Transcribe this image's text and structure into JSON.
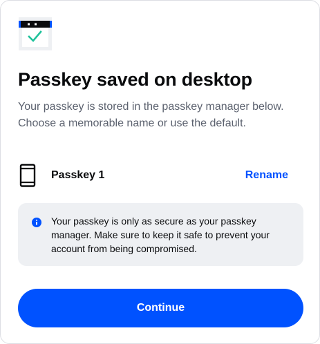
{
  "header": {
    "icon": "calendar-check-icon",
    "title": "Passkey saved on desktop",
    "subtitle": "Your passkey is stored in the passkey manager below. Choose a memorable name or use the default."
  },
  "passkey": {
    "icon": "phone-icon",
    "name": "Passkey 1",
    "rename_label": "Rename"
  },
  "info": {
    "icon": "info-icon",
    "text": "Your passkey is only as secure as your passkey manager. Make sure to keep it safe to prevent your account from being compromised."
  },
  "actions": {
    "continue_label": "Continue"
  },
  "colors": {
    "primary": "#0052ff",
    "check": "#1fc29b",
    "info_bg": "#eef0f3",
    "text_secondary": "#5b616e"
  }
}
